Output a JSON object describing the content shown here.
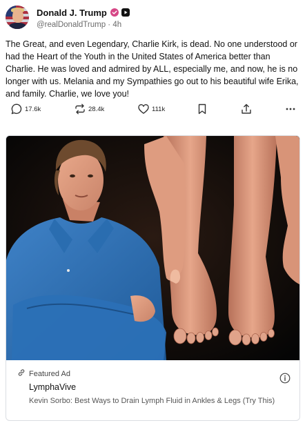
{
  "post": {
    "author": {
      "display_name": "Donald J. Trump",
      "handle": "@realDonaldTrump",
      "time_ago": "4h"
    },
    "body": "The Great, and even Legendary, Charlie Kirk, is dead. No one understood or had the Heart of the Youth in the United States of America better than Charlie. He was loved and admired by ALL, especially me, and now, he is no longer with us. Melania and my Sympathies go out to his beautiful wife Erika, and family. Charlie, we love you!",
    "actions": {
      "replies": "17.6k",
      "reposts": "28.4k",
      "likes": "111k"
    }
  },
  "ad": {
    "featured_label": "Featured Ad",
    "advertiser": "LymphaVive",
    "description": "Kevin Sorbo: Best Ways to Drain Lymph Fluid in Ankles & Legs (Try This)"
  },
  "icons": {
    "reply": "comment-icon",
    "repost": "repost-icon",
    "like": "heart-icon",
    "bookmark": "bookmark-icon",
    "share": "share-icon",
    "more": "more-icon",
    "verified": "verified-badge-icon",
    "link": "link-icon",
    "info": "info-icon"
  },
  "colors": {
    "verified_badge": "#d64686",
    "shirt_blue": "#2c6fb4",
    "text_secondary": "#6b6b6b"
  }
}
